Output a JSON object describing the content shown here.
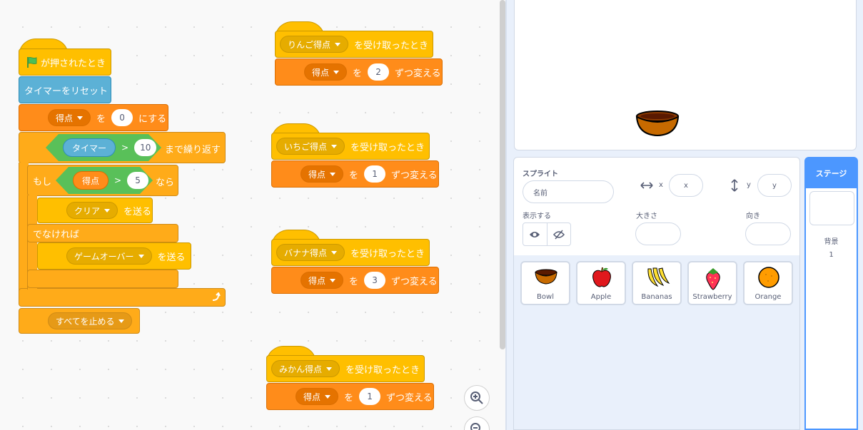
{
  "script_main": {
    "flag_label": "が押されたとき",
    "reset_timer": "タイマーをリセット",
    "set_var": {
      "var": "得点",
      "word_wo": "を",
      "value": "0",
      "word_suru": "にする"
    },
    "repeat_until": {
      "reporter": "タイマー",
      "op": ">",
      "value": "10",
      "suffix": "まで繰り返す"
    },
    "if_else": {
      "if_word": "もし",
      "reporter": "得点",
      "op": ">",
      "value": "5",
      "then_word": "なら",
      "else_word": "でなければ"
    },
    "broadcast_clear": {
      "message": "クリア",
      "suffix": "を送る"
    },
    "broadcast_gameover": {
      "message": "ゲームオーバー",
      "suffix": "を送る"
    },
    "stop_all": "すべてを止める"
  },
  "receive_scripts": [
    {
      "message": "りんご得点",
      "suffix": "を受け取ったとき",
      "var": "得点",
      "word_wo": "を",
      "amount": "2",
      "change": "ずつ変える"
    },
    {
      "message": "いちご得点",
      "suffix": "を受け取ったとき",
      "var": "得点",
      "word_wo": "を",
      "amount": "1",
      "change": "ずつ変える"
    },
    {
      "message": "バナナ得点",
      "suffix": "を受け取ったとき",
      "var": "得点",
      "word_wo": "を",
      "amount": "3",
      "change": "ずつ変える"
    },
    {
      "message": "みかん得点",
      "suffix": "を受け取ったとき",
      "var": "得点",
      "word_wo": "を",
      "amount": "1",
      "change": "ずつ変える"
    }
  ],
  "sprite_info": {
    "sprite_label": "スプライト",
    "name_placeholder": "名前",
    "x_label": "x",
    "x_placeholder": "x",
    "y_label": "y",
    "y_placeholder": "y",
    "show_label": "表示する",
    "size_label": "大きさ",
    "direction_label": "向き"
  },
  "sprites": [
    {
      "name": "Bowl"
    },
    {
      "name": "Apple"
    },
    {
      "name": "Bananas"
    },
    {
      "name": "Strawberry"
    },
    {
      "name": "Orange"
    }
  ],
  "stage_pane": {
    "title": "ステージ",
    "backdrops_label": "背景",
    "backdrops_count": "1"
  },
  "colors": {
    "events": "#ffbf00",
    "variables": "#ff8c1a",
    "control": "#ffab19",
    "sensing": "#5cb1d6",
    "operators": "#59c059",
    "accent": "#4c97ff"
  }
}
